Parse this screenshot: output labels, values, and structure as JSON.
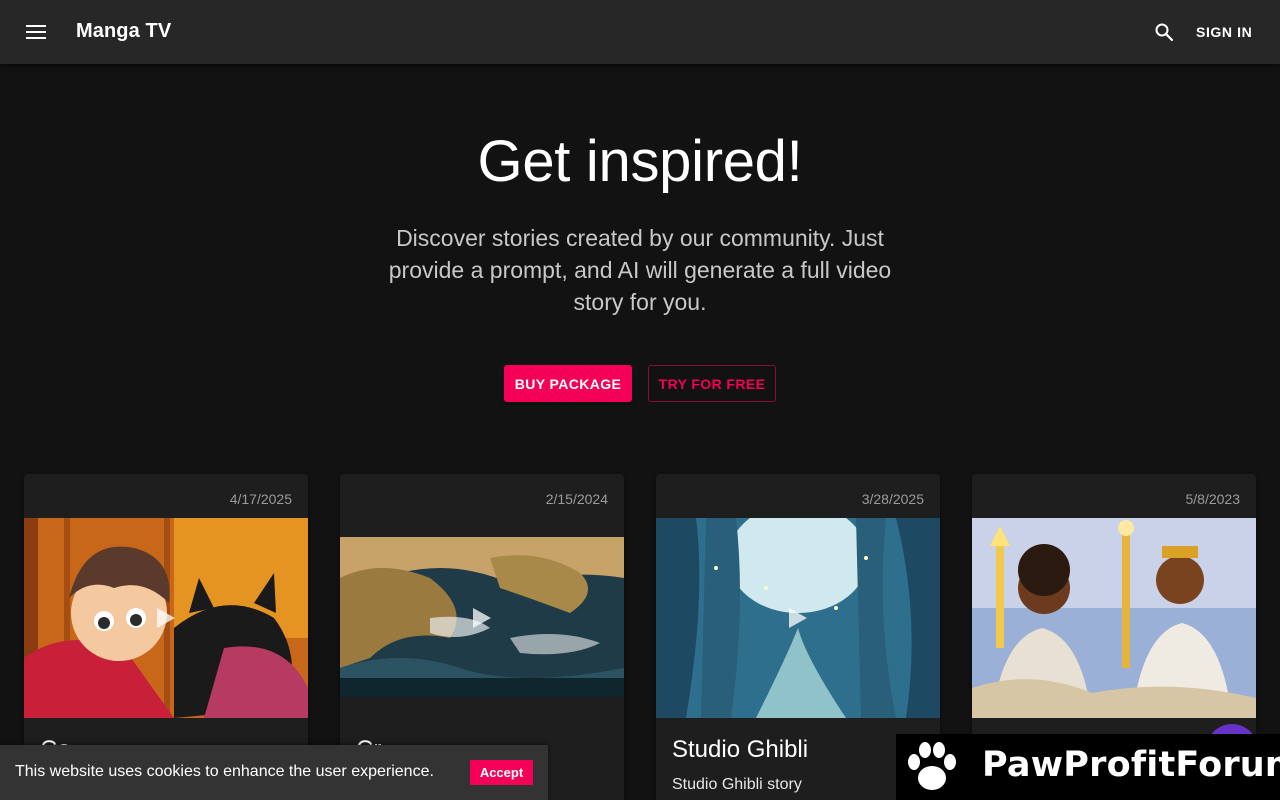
{
  "app": {
    "title": "Manga TV",
    "sign_in_label": "SIGN IN",
    "menu_icon": "menu-icon",
    "search_icon": "search-icon"
  },
  "hero": {
    "title": "Get inspired!",
    "subtitle": "Discover stories created by our community. Just provide a prompt, and AI will generate a full video story for you.",
    "buy_label": "BUY PACKAGE",
    "try_label": "TRY FOR FREE"
  },
  "cards": [
    {
      "date": "4/17/2025",
      "title": "Ce...",
      "description": "",
      "thumbnail": "boy-with-black-cat"
    },
    {
      "date": "2/15/2024",
      "title": "Cr...",
      "description": "",
      "thumbnail": "rocky-coastline"
    },
    {
      "date": "3/28/2025",
      "title": "Studio Ghibli",
      "description": "Studio Ghibli story",
      "thumbnail": "enchanted-blue-forest"
    },
    {
      "date": "5/8/2023",
      "title": "",
      "description": "",
      "thumbnail": "two-warriors-with-staffs"
    }
  ],
  "cookie": {
    "message": "This website uses cookies to enhance the user experience.",
    "accept_label": "Accept"
  },
  "watermark": {
    "text": "PawProfitForum"
  },
  "colors": {
    "background": "#121212",
    "appbar": "#272727",
    "accent": "#f50057",
    "card": "#1e1e1e",
    "fab": "#6a31c9"
  }
}
